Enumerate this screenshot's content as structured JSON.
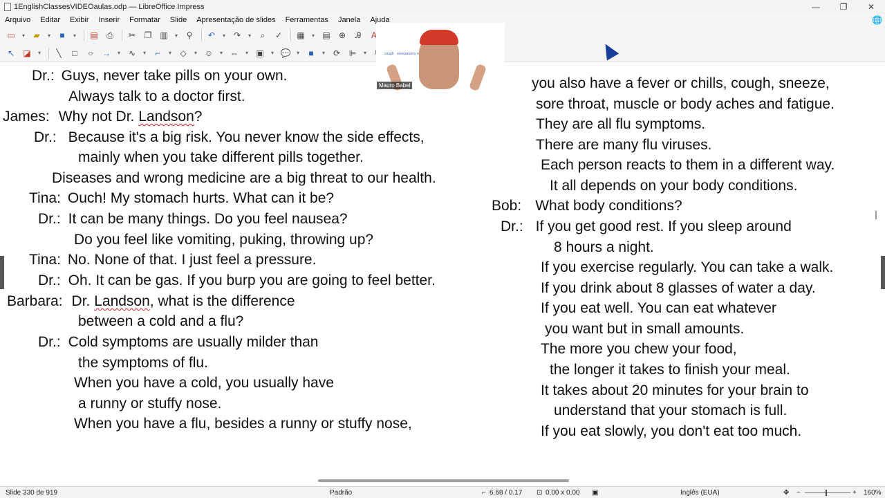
{
  "window": {
    "title": "1EnglishClassesVIDEOaulas.odp — LibreOffice Impress",
    "minimize": "—",
    "maximize": "❐",
    "close": "✕"
  },
  "menu": [
    "Arquivo",
    "Editar",
    "Exibir",
    "Inserir",
    "Formatar",
    "Slide",
    "Apresentação de slides",
    "Ferramentas",
    "Janela",
    "Ajuda"
  ],
  "colors": {
    "squiggle": "#d02020",
    "cursor": "#1a3d9a"
  },
  "slide": {
    "left": [
      {
        "speaker": "Dr.:",
        "text": "Guys, never take pills on your own."
      },
      {
        "speaker": "",
        "text": "Always talk to a doctor first."
      },
      {
        "speaker": "James:",
        "text_before": "Why not Dr. ",
        "squiggle": "Landson",
        "text_after": "?"
      },
      {
        "speaker": "Dr.:",
        "text": "Because it's a big risk. You never know the side effects,"
      },
      {
        "speaker": "",
        "text": "mainly when you take different pills together."
      },
      {
        "speaker": "",
        "text": "Diseases and wrong medicine are a big threat to our health."
      },
      {
        "speaker": "Tina:",
        "text": "Ouch! My stomach hurts. What can it be?"
      },
      {
        "speaker": "Dr.:",
        "text": "It can be many things. Do you feel nausea?"
      },
      {
        "speaker": "",
        "text": "Do you feel like vomiting, puking, throwing up?"
      },
      {
        "speaker": "Tina:",
        "text": "No. None of that. I just feel a pressure."
      },
      {
        "speaker": "Dr.:",
        "text": "Oh. It can be gas. If you burp you are going to feel better."
      },
      {
        "speaker": "Barbara:",
        "text_before": "Dr. ",
        "squiggle": "Landson",
        "text_after": ", what is the difference"
      },
      {
        "speaker": "",
        "text": "between a cold and a flu?"
      },
      {
        "speaker": "Dr.:",
        "text": "Cold symptoms are usually milder than"
      },
      {
        "speaker": "",
        "text": "the symptoms of flu."
      },
      {
        "speaker": "",
        "text": "When you have a cold, you usually have"
      },
      {
        "speaker": "",
        "text": "a runny or stuffy nose."
      },
      {
        "speaker": "",
        "text": "When you have a flu, besides a runny or stuffy nose,"
      }
    ],
    "right": [
      {
        "speaker": "",
        "text": "you also have a fever or chills, cough, sneeze,"
      },
      {
        "speaker": "",
        "text": "sore throat, muscle or body aches and fatigue."
      },
      {
        "speaker": "",
        "text": "They are all flu symptoms."
      },
      {
        "speaker": "",
        "text": "There are many flu viruses."
      },
      {
        "speaker": "",
        "text": "Each person reacts to them in a different way."
      },
      {
        "speaker": "",
        "text": "It all depends on your body conditions."
      },
      {
        "speaker": "Bob:",
        "text": "What body conditions?"
      },
      {
        "speaker": "Dr.:",
        "text": "If you get good rest. If you sleep around"
      },
      {
        "speaker": "",
        "text": "8 hours a night."
      },
      {
        "speaker": "",
        "text": "If you exercise regularly. You can take a walk."
      },
      {
        "speaker": "",
        "text": "If you drink about 8 glasses of water a day."
      },
      {
        "speaker": "",
        "text": "If you eat well. You can eat whatever"
      },
      {
        "speaker": "",
        "text": "you want but in small amounts."
      },
      {
        "speaker": "",
        "text": "The more you chew your food,"
      },
      {
        "speaker": "",
        "text": "the longer it takes to finish your meal."
      },
      {
        "speaker": "",
        "text": "It takes about 20 minutes for your brain to"
      },
      {
        "speaker": "",
        "text": "understand that your stomach is full."
      },
      {
        "speaker": "",
        "text": "If you eat slowly, you don't eat too much."
      }
    ]
  },
  "video": {
    "presenter_name": "Mauro Babel",
    "mini_labels": [
      "cough",
      "sneeze",
      "runny nose"
    ]
  },
  "status": {
    "slide": "Slide 330 de 919",
    "master": "Padrão",
    "position": "6.68 / 0.17",
    "size": "0.00 x 0.00",
    "language": "Inglês (EUA)",
    "zoom": "160%",
    "zoom_minus": "−",
    "zoom_plus": "+"
  }
}
